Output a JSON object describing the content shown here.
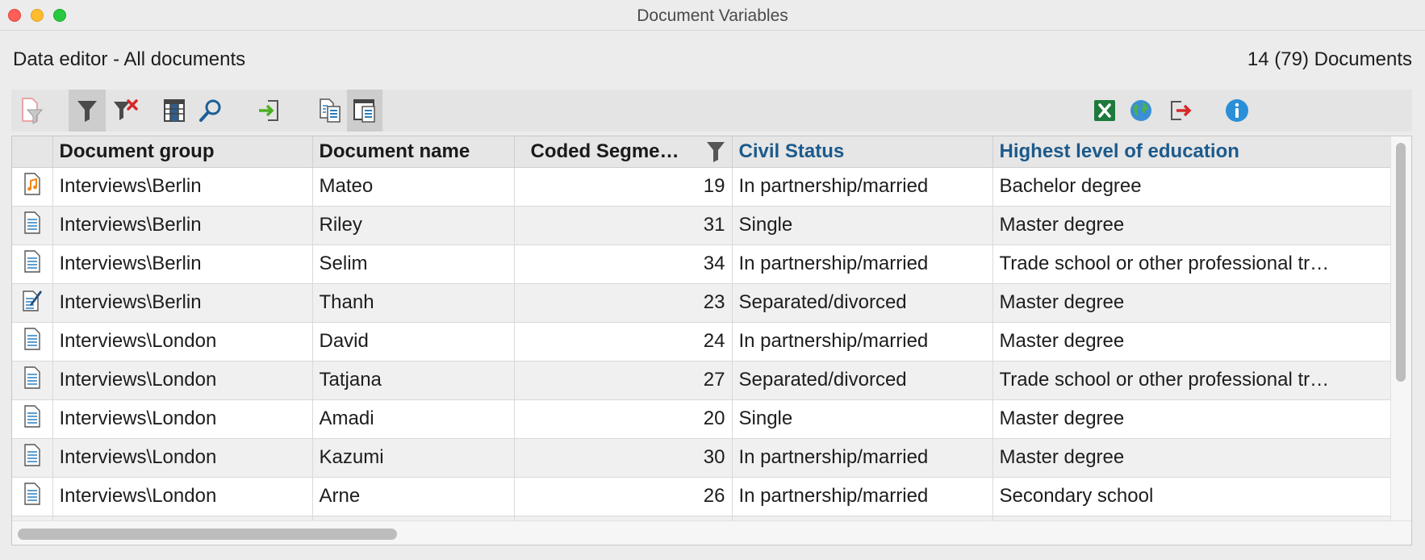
{
  "window": {
    "title": "Document Variables"
  },
  "header": {
    "title": "Data editor - All documents",
    "count": "14 (79) Documents"
  },
  "toolbar": {
    "left": [
      "filter-document-icon",
      "filter-icon",
      "clear-filter-icon",
      "columns-icon",
      "search-icon",
      "import-icon",
      "document-list-icon",
      "document-view-icon"
    ],
    "right": [
      "excel-icon",
      "globe-icon",
      "export-icon",
      "info-icon"
    ]
  },
  "table": {
    "headers": {
      "group": "Document group",
      "name": "Document name",
      "coded": "Coded Segme…",
      "civil": "Civil Status",
      "edu": "Highest level of education"
    },
    "rows": [
      {
        "icon": "audio-document-icon",
        "group": "Interviews\\Berlin",
        "name": "Mateo",
        "coded": "19",
        "civil": "In partnership/married",
        "edu": "Bachelor degree"
      },
      {
        "icon": "text-document-icon",
        "group": "Interviews\\Berlin",
        "name": "Riley",
        "coded": "31",
        "civil": "Single",
        "edu": "Master degree"
      },
      {
        "icon": "text-document-icon",
        "group": "Interviews\\Berlin",
        "name": "Selim",
        "coded": "34",
        "civil": "In partnership/married",
        "edu": "Trade school or other professional tr…"
      },
      {
        "icon": "edit-document-icon",
        "group": "Interviews\\Berlin",
        "name": "Thanh",
        "coded": "23",
        "civil": "Separated/divorced",
        "edu": "Master degree"
      },
      {
        "icon": "text-document-icon",
        "group": "Interviews\\London",
        "name": "David",
        "coded": "24",
        "civil": "In partnership/married",
        "edu": "Master degree"
      },
      {
        "icon": "text-document-icon",
        "group": "Interviews\\London",
        "name": "Tatjana",
        "coded": "27",
        "civil": "Separated/divorced",
        "edu": "Trade school or other professional tr…"
      },
      {
        "icon": "text-document-icon",
        "group": "Interviews\\London",
        "name": "Amadi",
        "coded": "20",
        "civil": "Single",
        "edu": "Master degree"
      },
      {
        "icon": "text-document-icon",
        "group": "Interviews\\London",
        "name": "Kazumi",
        "coded": "30",
        "civil": "In partnership/married",
        "edu": "Master degree"
      },
      {
        "icon": "text-document-icon",
        "group": "Interviews\\London",
        "name": "Arne",
        "coded": "26",
        "civil": "In partnership/married",
        "edu": "Secondary school"
      },
      {
        "icon": "text-document-icon",
        "group": "",
        "name": "",
        "coded": "",
        "civil": "",
        "edu": ""
      }
    ]
  },
  "colors": {
    "variable_header": "#1c5a8c",
    "accent_blue": "#2a7fc1"
  }
}
